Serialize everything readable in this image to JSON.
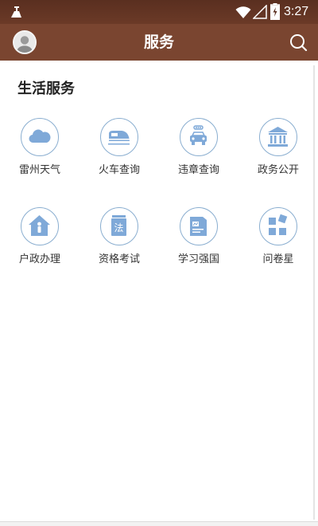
{
  "status_bar": {
    "time": "3:27"
  },
  "header": {
    "title": "服务"
  },
  "section": {
    "title": "生活服务"
  },
  "services": [
    {
      "label": "雷州天气",
      "icon": "cloud-icon"
    },
    {
      "label": "火车查询",
      "icon": "train-icon"
    },
    {
      "label": "违章查询",
      "icon": "car-icon"
    },
    {
      "label": "政务公开",
      "icon": "government-building-icon"
    },
    {
      "label": "户政办理",
      "icon": "household-icon"
    },
    {
      "label": "资格考试",
      "icon": "law-book-icon"
    },
    {
      "label": "学习强国",
      "icon": "study-book-icon"
    },
    {
      "label": "问卷星",
      "icon": "survey-grid-icon"
    }
  ],
  "colors": {
    "status_bar": "#5a2f20",
    "app_bar": "#7a4530",
    "icon_blue": "#7fa9d8",
    "icon_ring": "#8aaed0"
  }
}
